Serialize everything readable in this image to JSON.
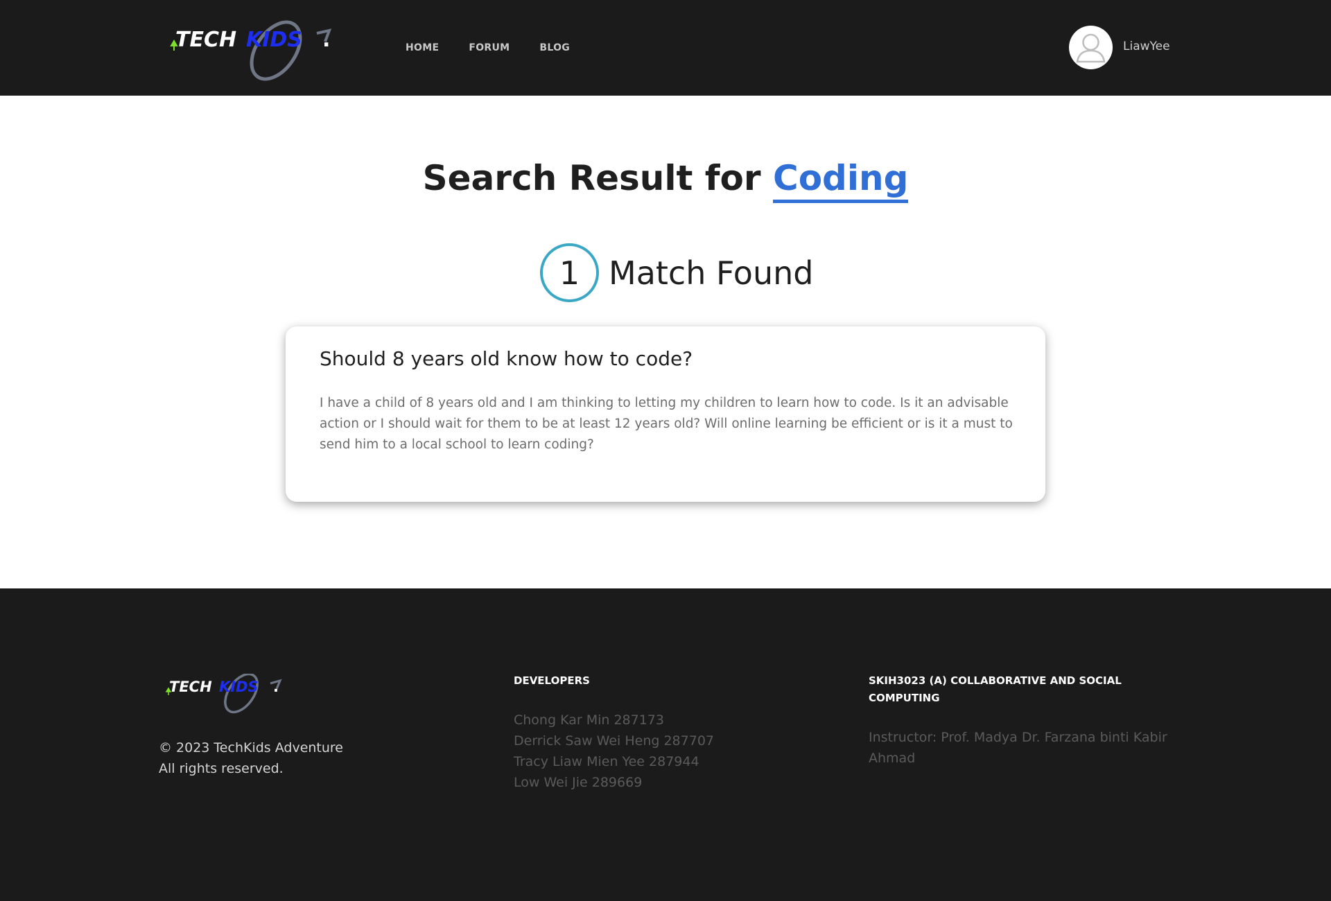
{
  "header": {
    "logo": {
      "text_tech": "TECH",
      "text_kids": "KIDS",
      "text_dot": ".",
      "colors": {
        "tech": "#ffffff",
        "kids": "#1d2ef0",
        "arrow": "#7fe02a",
        "swoosh": "#6f7787"
      }
    },
    "nav": [
      {
        "label": "HOME"
      },
      {
        "label": "FORUM"
      },
      {
        "label": "BLOG"
      }
    ],
    "user": {
      "name": "LiawYee",
      "avatar_icon": "user-avatar-icon"
    }
  },
  "search": {
    "prefix": "Search Result for",
    "term": "Coding",
    "match_count": "1",
    "match_label": "Match Found"
  },
  "results": [
    {
      "title": "Should 8 years old know how to code?",
      "body": "I have a child of 8 years old and I am thinking to letting my children to learn how to code. Is it an advisable action or I should wait for them to be at least 12 years old? Will online learning be efficient or is it a must to send him to a local school to learn coding?"
    }
  ],
  "footer": {
    "copyright_line1": "© 2023 TechKids Adventure",
    "copyright_line2": "All rights reserved.",
    "developers_title": "DEVELOPERS",
    "developers": [
      "Chong Kar Min 287173",
      "Derrick Saw Wei Heng 287707",
      "Tracy Liaw Mien Yee 287944",
      "Low Wei Jie 289669"
    ],
    "course_title": "SKIH3023 (A) COLLABORATIVE AND SOCIAL COMPUTING",
    "instructor": "Instructor: Prof. Madya Dr. Farzana binti Kabir Ahmad"
  },
  "colors": {
    "header_bg": "#1b1b1b",
    "accent_blue": "#2f6fd6",
    "match_circle": "#3aa7c4"
  }
}
